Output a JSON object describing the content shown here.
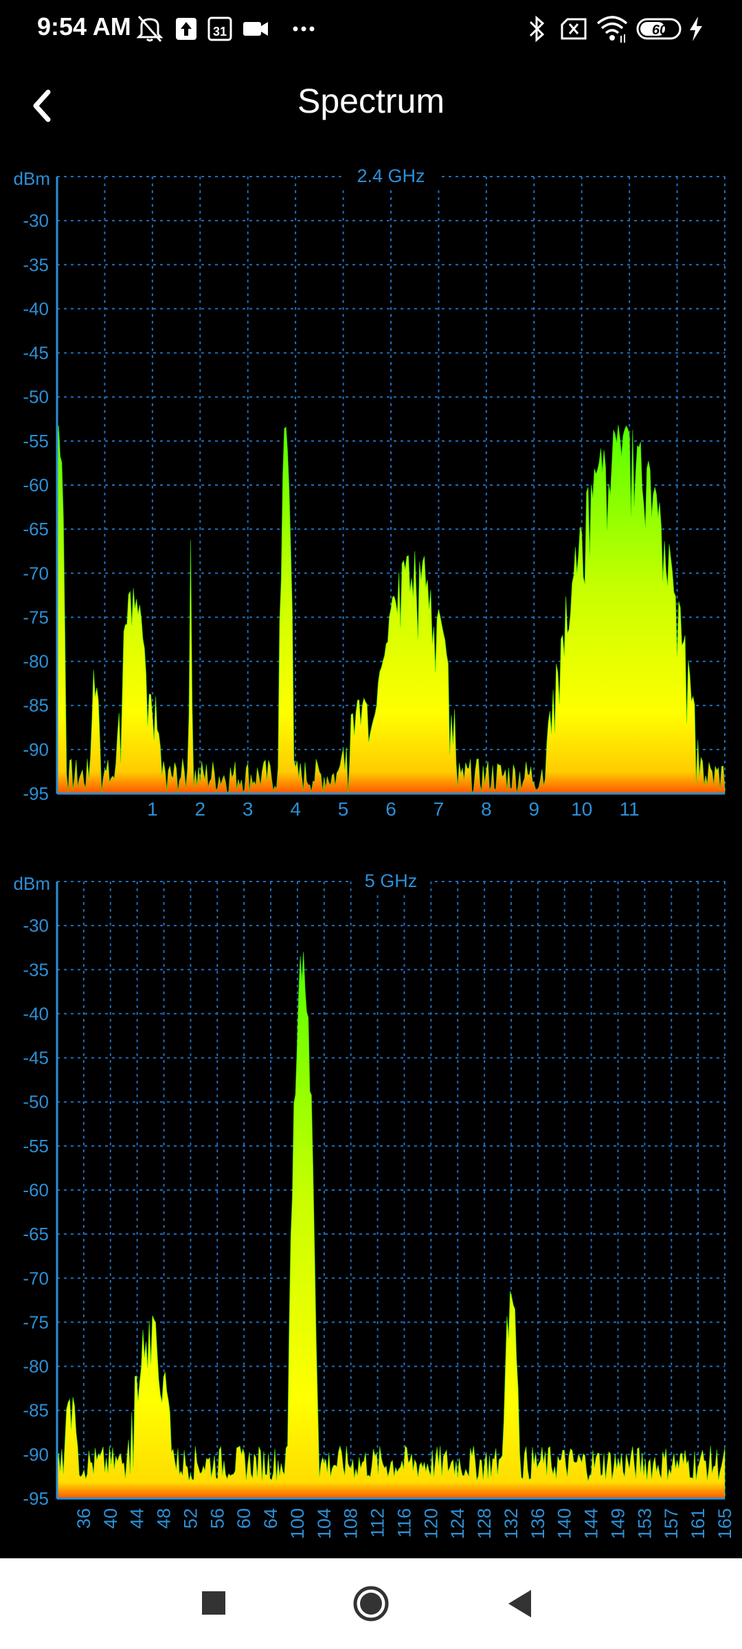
{
  "status_bar": {
    "time": "9:54 AM",
    "left_icons": [
      "alarm-off-icon",
      "upload-icon",
      "calendar-icon",
      "video-camera-icon",
      "more-dots-icon"
    ],
    "right_icons": [
      "bluetooth-icon",
      "sim-error-icon",
      "wifi-icon",
      "battery-icon",
      "charging-icon"
    ],
    "calendar_day": "31",
    "battery_level": "60"
  },
  "app_bar": {
    "title": "Spectrum",
    "back_icon": "chevron-left-icon"
  },
  "colors": {
    "grid": "#1e6fbe",
    "axis_text": "#2c8fd6",
    "signal_low": "#ff4a00",
    "signal_mid": "#ffee00",
    "signal_high": "#66ff00",
    "background": "#000000"
  },
  "chart_data": [
    {
      "type": "area",
      "title": "2.4 GHz",
      "ylabel": "dBm",
      "xlabel": "",
      "ylim": [
        -95,
        -25
      ],
      "yticks": [
        -30,
        -35,
        -40,
        -45,
        -50,
        -55,
        -60,
        -65,
        -70,
        -75,
        -80,
        -85,
        -90,
        -95
      ],
      "xlim": [
        -1,
        13
      ],
      "xticks": [
        {
          "label": "1",
          "x": 1
        },
        {
          "label": "2",
          "x": 2
        },
        {
          "label": "3",
          "x": 3
        },
        {
          "label": "4",
          "x": 4
        },
        {
          "label": "5",
          "x": 5
        },
        {
          "label": "6",
          "x": 6
        },
        {
          "label": "7",
          "x": 7
        },
        {
          "label": "8",
          "x": 8
        },
        {
          "label": "9",
          "x": 9
        },
        {
          "label": "10",
          "x": 10
        },
        {
          "label": "11",
          "x": 11
        }
      ],
      "grid": true,
      "noise_floor": -93,
      "series": [
        {
          "peak_x": -0.95,
          "width": 0.15,
          "peak_dbm": -50
        },
        {
          "peak_x": -0.2,
          "width": 0.12,
          "peak_dbm": -79
        },
        {
          "peak_x": 0.6,
          "width": 0.4,
          "peak_dbm": -71
        },
        {
          "peak_x": 1.0,
          "width": 0.35,
          "peak_dbm": -83
        },
        {
          "peak_x": 1.8,
          "width": 0.04,
          "peak_dbm": -66
        },
        {
          "peak_x": 3.8,
          "width": 0.18,
          "peak_dbm": -51
        },
        {
          "peak_x": 5.4,
          "width": 0.5,
          "peak_dbm": -84
        },
        {
          "peak_x": 6.5,
          "width": 1.0,
          "peak_dbm": -67
        },
        {
          "peak_x": 10.85,
          "width": 1.7,
          "peak_dbm": -53
        }
      ]
    },
    {
      "type": "area",
      "title": "5 GHz",
      "ylabel": "dBm",
      "xlabel": "",
      "ylim": [
        -95,
        -25
      ],
      "yticks": [
        -30,
        -35,
        -40,
        -45,
        -50,
        -55,
        -60,
        -65,
        -70,
        -75,
        -80,
        -85,
        -90,
        -95
      ],
      "xlim": [
        -1,
        24
      ],
      "xticks": [
        {
          "label": "36",
          "x": 0
        },
        {
          "label": "40",
          "x": 1
        },
        {
          "label": "44",
          "x": 2
        },
        {
          "label": "48",
          "x": 3
        },
        {
          "label": "52",
          "x": 4
        },
        {
          "label": "56",
          "x": 5
        },
        {
          "label": "60",
          "x": 6
        },
        {
          "label": "64",
          "x": 7
        },
        {
          "label": "100",
          "x": 8
        },
        {
          "label": "104",
          "x": 9
        },
        {
          "label": "108",
          "x": 10
        },
        {
          "label": "112",
          "x": 11
        },
        {
          "label": "116",
          "x": 12
        },
        {
          "label": "120",
          "x": 13
        },
        {
          "label": "124",
          "x": 14
        },
        {
          "label": "128",
          "x": 15
        },
        {
          "label": "132",
          "x": 16
        },
        {
          "label": "136",
          "x": 17
        },
        {
          "label": "140",
          "x": 18
        },
        {
          "label": "144",
          "x": 19
        },
        {
          "label": "149",
          "x": 20
        },
        {
          "label": "153",
          "x": 21
        },
        {
          "label": "157",
          "x": 22
        },
        {
          "label": "161",
          "x": 23
        },
        {
          "label": "165",
          "x": 24
        }
      ],
      "grid": true,
      "noise_floor": -91,
      "series": [
        {
          "peak_x": -0.5,
          "width": 0.3,
          "peak_dbm": -82
        },
        {
          "peak_x": 2.5,
          "width": 0.9,
          "peak_dbm": -74
        },
        {
          "peak_x": 8.2,
          "width": 0.6,
          "peak_dbm": -32
        },
        {
          "peak_x": 16.0,
          "width": 0.35,
          "peak_dbm": -70
        }
      ]
    }
  ],
  "nav_bar": {
    "buttons": [
      "recents-square-icon",
      "home-circle-icon",
      "back-triangle-icon"
    ]
  }
}
